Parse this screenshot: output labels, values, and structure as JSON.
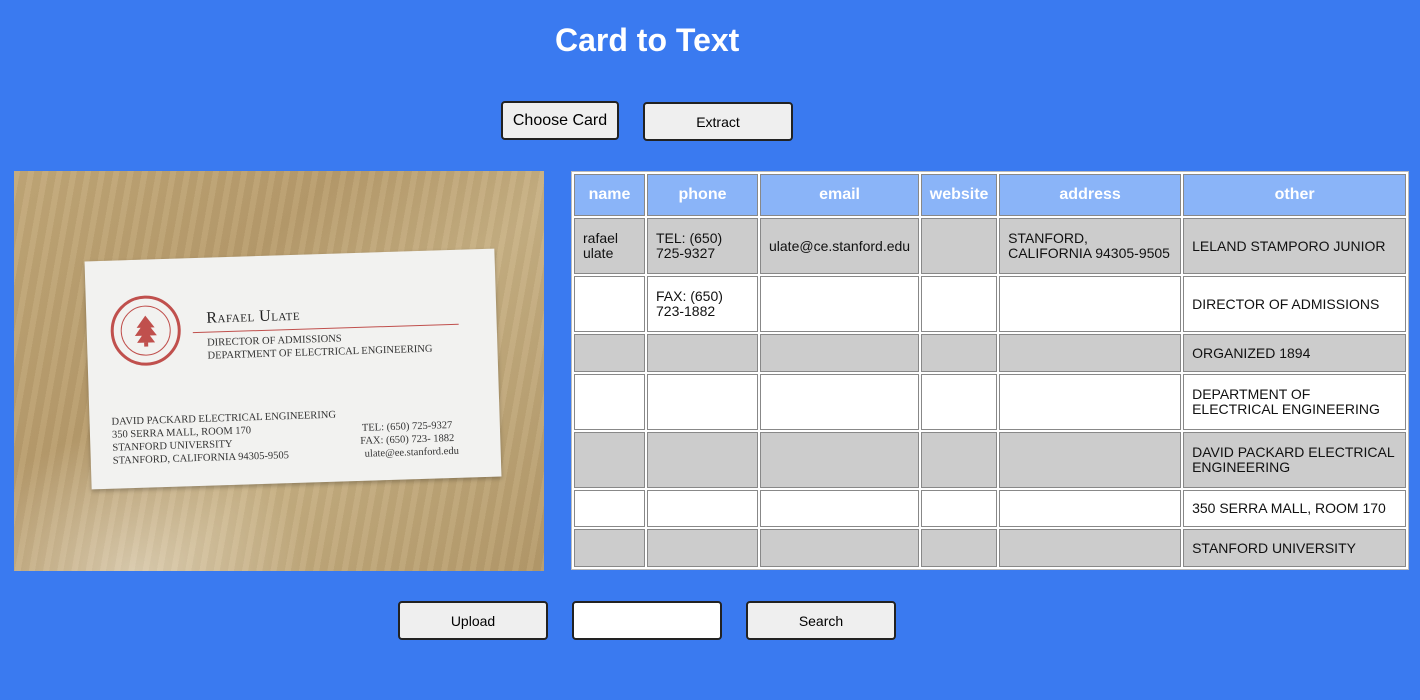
{
  "header": {
    "title": "Card to Text"
  },
  "toolbar": {
    "choose_label": "Choose Card",
    "extract_label": "Extract"
  },
  "card": {
    "name": "Rafael Ulate",
    "title_line1": "DIRECTOR OF ADMISSIONS",
    "title_line2": "DEPARTMENT OF ELECTRICAL ENGINEERING",
    "address_line1": "DAVID PACKARD ELECTRICAL ENGINEERING",
    "address_line2": "350 SERRA MALL, ROOM 170",
    "address_line3": "STANFORD UNIVERSITY",
    "address_line4": "STANFORD, CALIFORNIA 94305-9505",
    "tel": "TEL: (650) 725-9327",
    "fax": "FAX: (650) 723- 1882",
    "email": "ulate@ee.stanford.edu",
    "seal_color": "#c0504d"
  },
  "table": {
    "headers": [
      "name",
      "phone",
      "email",
      "website",
      "address",
      "other"
    ],
    "rows": [
      [
        "rafael ulate",
        "TEL: (650) 725-9327",
        "ulate@ce.stanford.edu",
        "",
        "STANFORD, CALIFORNIA 94305-9505",
        "LELAND STAMPORO JUNIOR"
      ],
      [
        "",
        "FAX: (650) 723-1882",
        "",
        "",
        "",
        "DIRECTOR OF ADMISSIONS"
      ],
      [
        "",
        "",
        "",
        "",
        "",
        "ORGANIZED 1894"
      ],
      [
        "",
        "",
        "",
        "",
        "",
        "DEPARTMENT OF ELECTRICAL ENGINEERING"
      ],
      [
        "",
        "",
        "",
        "",
        "",
        "DAVID PACKARD ELECTRICAL ENGINEERING"
      ],
      [
        "",
        "",
        "",
        "",
        "",
        "350 SERRA MALL, ROOM 170"
      ],
      [
        "",
        "",
        "",
        "",
        "",
        "STANFORD UNIVERSITY"
      ]
    ]
  },
  "footer": {
    "upload_label": "Upload",
    "search_value": "",
    "search_label": "Search"
  },
  "colors": {
    "background": "#3a7af0",
    "header_cell": "#8ab4f8",
    "odd_row": "#cccccc",
    "even_row": "#ffffff"
  }
}
